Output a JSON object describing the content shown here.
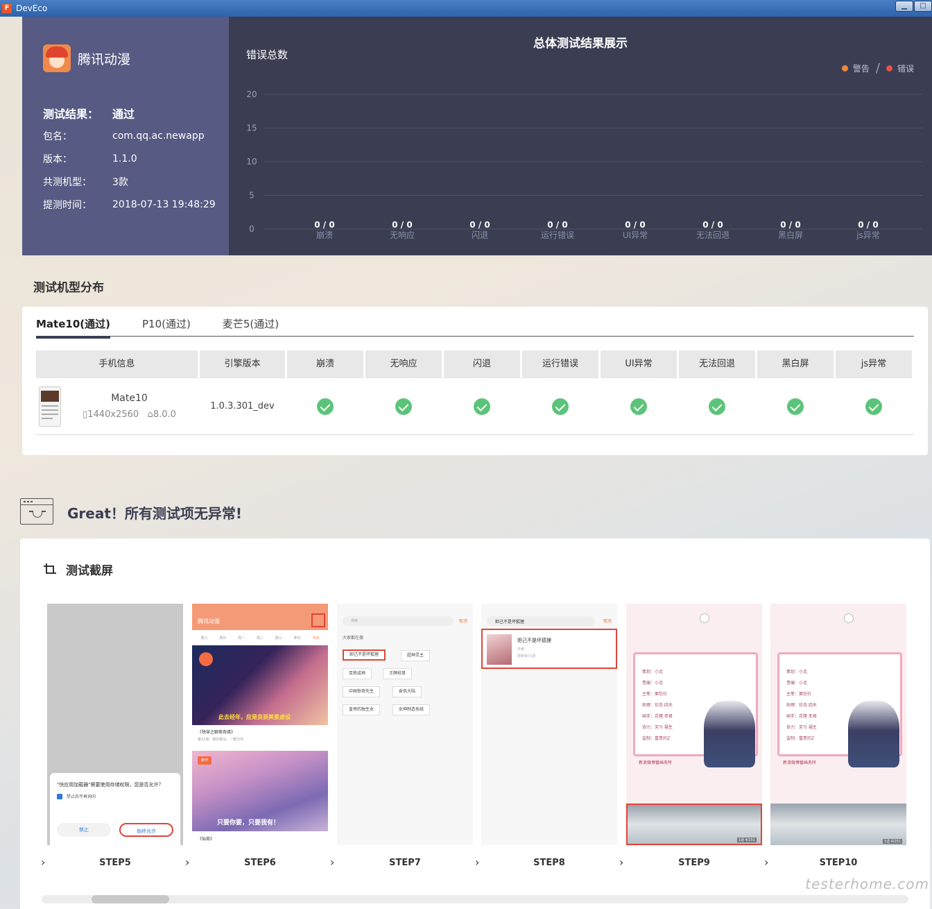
{
  "window": {
    "title": "DevEco"
  },
  "app": {
    "name": "腾讯动漫",
    "info": [
      {
        "key": "测试结果：",
        "value": "通过"
      },
      {
        "key": "包名：",
        "value": "com.qq.ac.newapp"
      },
      {
        "key": "版本：",
        "value": "1.1.0"
      },
      {
        "key": "共测机型：",
        "value": "3款"
      },
      {
        "key": "提测时间：",
        "value": "2018-07-13 19:48:29"
      }
    ]
  },
  "chart_data": {
    "type": "bar",
    "title": "总体测试结果展示",
    "ylabel": "错误总数",
    "ylim": [
      0,
      20
    ],
    "yticks": [
      0,
      5,
      10,
      15,
      20
    ],
    "categories": [
      "崩溃",
      "无响应",
      "闪退",
      "运行错误",
      "UI异常",
      "无法回退",
      "黑白屏",
      "js异常"
    ],
    "value_labels": [
      "0 / 0",
      "0 / 0",
      "0 / 0",
      "0 / 0",
      "0 / 0",
      "0 / 0",
      "0 / 0",
      "0 / 0"
    ],
    "series": [
      {
        "name": "警告",
        "color": "#f0883a",
        "values": [
          0,
          0,
          0,
          0,
          0,
          0,
          0,
          0
        ]
      },
      {
        "name": "错误",
        "color": "#e8504a",
        "values": [
          0,
          0,
          0,
          0,
          0,
          0,
          0,
          0
        ]
      }
    ],
    "legend_position": "top-right",
    "grid": true
  },
  "models": {
    "heading": "测试机型分布",
    "tabs": [
      "Mate10(通过)",
      "P10(通过)",
      "麦芒5(通过)"
    ],
    "headers": [
      "手机信息",
      "引擎版本",
      "崩溃",
      "无响应",
      "闪退",
      "运行错误",
      "UI异常",
      "无法回退",
      "黑白屏",
      "js异常"
    ],
    "row": {
      "name": "Mate10",
      "resolution": "1440x2560",
      "os": "8.0.0",
      "engine": "1.0.3.301_dev",
      "status_icons": [
        "check-icon",
        "check-icon",
        "check-icon",
        "check-icon",
        "check-icon",
        "check-icon",
        "check-icon",
        "check-icon"
      ]
    }
  },
  "great": {
    "text": "Great！所有测试项无异常!"
  },
  "shots": {
    "title": "测试截屏",
    "steps": [
      "STEP5",
      "STEP6",
      "STEP7",
      "STEP8",
      "STEP9",
      "STEP10"
    ],
    "s1": {
      "dialog_text": "\"快应用加载器\"需要使用存储权限，您是否允许？",
      "checkbox": "禁止后不再询问",
      "deny": "禁止",
      "allow": "始终允许"
    },
    "s2": {
      "title": "腾讯动漫",
      "days": [
        "周六",
        "周日",
        "周一",
        "周二",
        "周三",
        "昨日",
        "今日"
      ],
      "banner1": "此去经年，应是良辰美景虚设",
      "caption1": "《快穿之聊斋奇缘》",
      "caption1b": "第32话：鲜衣怒马，一眼万年",
      "tag2": "新作",
      "banner2": "只要你要，只要我有！",
      "caption2": "《仙商》"
    },
    "s3": {
      "search_placeholder": "搜索",
      "cancel": "取消",
      "hint": "大家都在搜",
      "chips": [
        "妲己不是坏狐狸",
        "超神灵主",
        "百炼成神",
        "王牌校草",
        "中国惊奇先生",
        "食色大陆",
        "皇帝的独生女",
        "女神制造系统"
      ]
    },
    "s4": {
      "query": "妲己不是坏狐狸",
      "cancel": "取消",
      "result_name": "妲己不是坏狐狸",
      "result_meta1": "作者：",
      "result_meta2": "更新到72话"
    },
    "card": {
      "lines": [
        "策划：小北",
        "责编：小北",
        "主笔：面包社",
        "助理：珍岛 四天",
        "画手：花猪 老君",
        "协力：芙兮 福生",
        "监制：富贵的Z"
      ],
      "footer": "新浪微博番画务所",
      "page": "1话 4/251"
    }
  },
  "watermark": "testerhome.com"
}
